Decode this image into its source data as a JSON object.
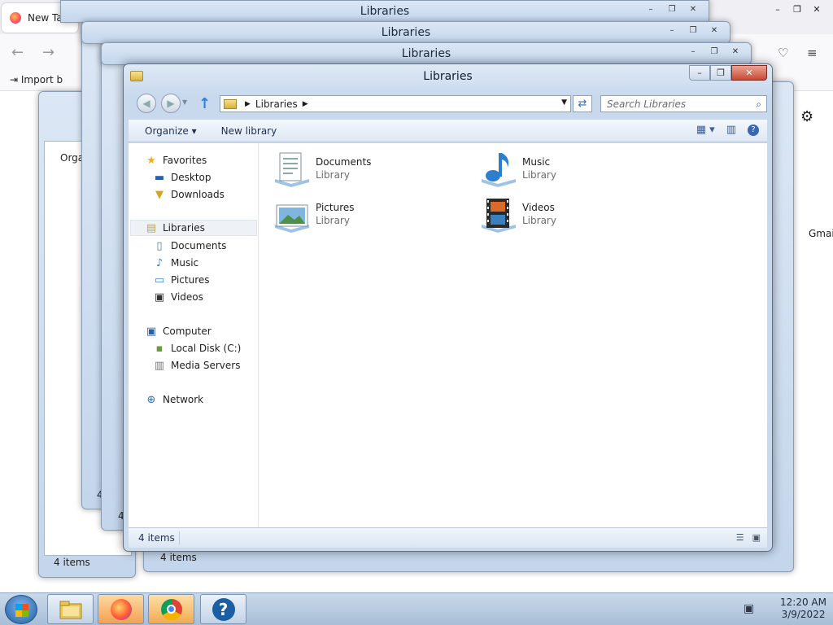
{
  "browser": {
    "tab_label": "New Tab",
    "import_label": "Import b",
    "gmail_label": "Gmail",
    "controls": [
      "–",
      "❐",
      "✕"
    ]
  },
  "ghosts": [
    {
      "title": "Libraries"
    },
    {
      "title": "Libraries"
    },
    {
      "title": "Libraries"
    }
  ],
  "ghost_left": {
    "cmd_label": "Orga",
    "status": "4 items"
  },
  "ghost_bottom": {
    "status": "4 items"
  },
  "ghost_mid": {
    "status": "4"
  },
  "ghost_mid2": {
    "status": "4"
  },
  "window": {
    "title": "Libraries",
    "address_crumb": "Libraries",
    "search_placeholder": "Search Libraries",
    "cmd": {
      "organize": "Organize",
      "new_library": "New library"
    },
    "status_count": "4 items",
    "controls": {
      "min": "–",
      "max": "❐",
      "close": "✕"
    }
  },
  "nav": {
    "favorites": "Favorites",
    "desktop": "Desktop",
    "downloads": "Downloads",
    "libraries": "Libraries",
    "documents": "Documents",
    "music": "Music",
    "pictures": "Pictures",
    "videos": "Videos",
    "computer": "Computer",
    "local_disk": "Local Disk (C:)",
    "media_servers": "Media Servers",
    "network": "Network"
  },
  "tiles": [
    {
      "name": "Documents",
      "sub": "Library"
    },
    {
      "name": "Music",
      "sub": "Library"
    },
    {
      "name": "Pictures",
      "sub": "Library"
    },
    {
      "name": "Videos",
      "sub": "Library"
    }
  ],
  "taskbar": {
    "time": "12:20 AM",
    "date": "3/9/2022"
  },
  "icons": {
    "start": "windows-logo-icon",
    "explorer": "folder-icon",
    "firefox": "firefox-icon",
    "chrome": "chrome-icon",
    "help": "help-icon"
  },
  "colors": {
    "close_button": "#c74a34",
    "title_bar": "#c8d9ee",
    "taskbar": "#a8bed6"
  }
}
